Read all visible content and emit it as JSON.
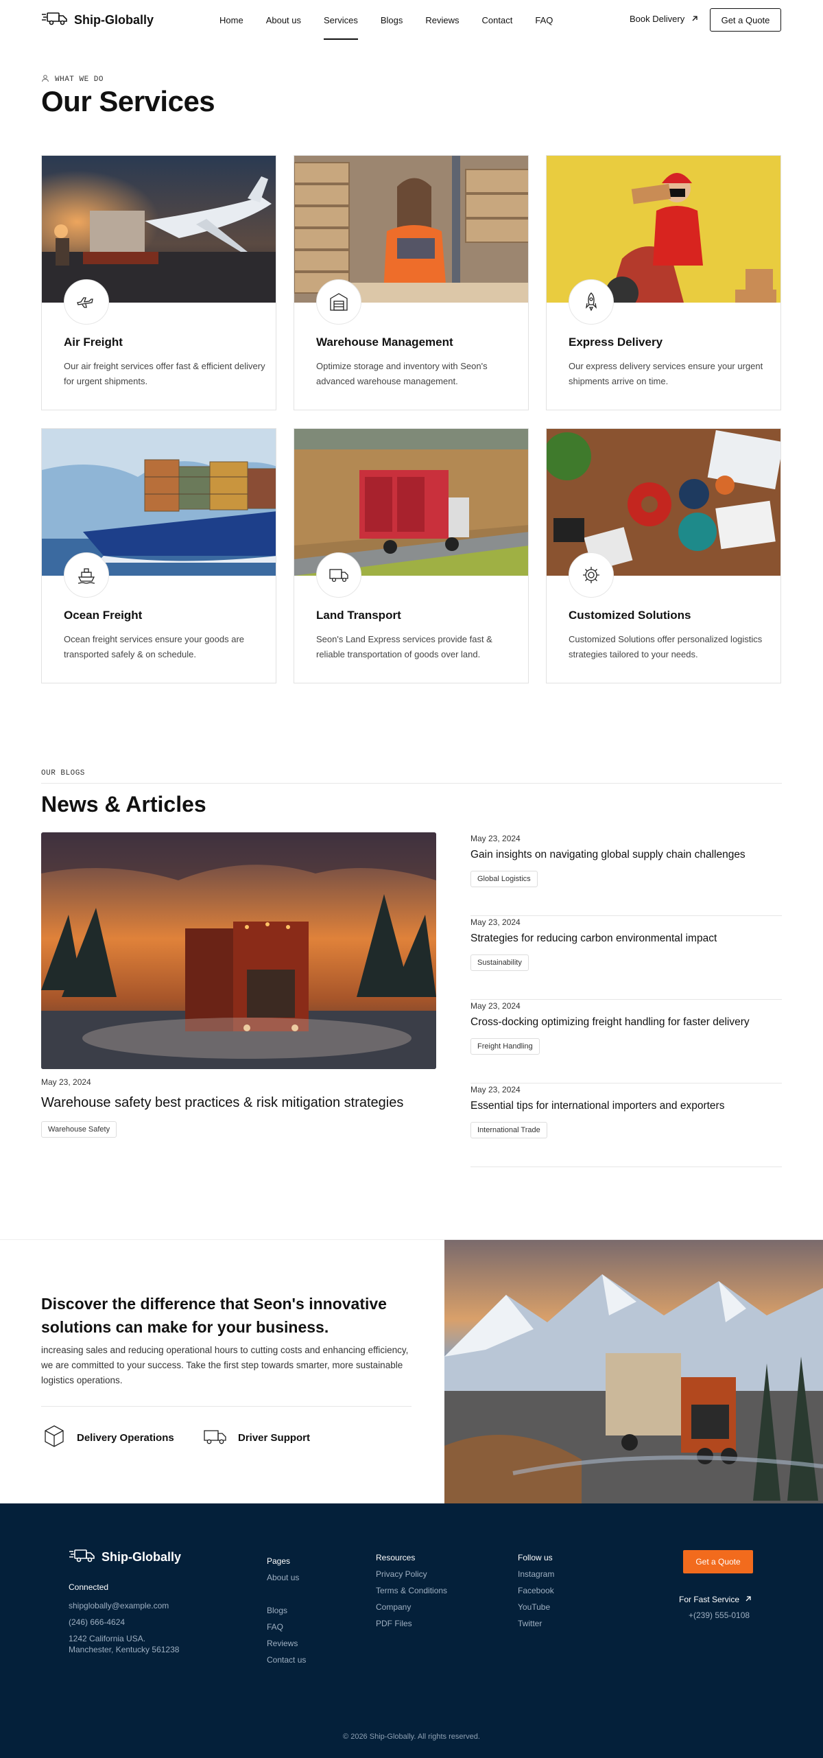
{
  "brand": "Ship-Globally",
  "nav": {
    "items": [
      "Home",
      "About us",
      "Services",
      "Blogs",
      "Reviews",
      "Contact",
      "FAQ"
    ],
    "active_index": 2,
    "book_delivery": "Book Delivery",
    "get_quote": "Get a Quote"
  },
  "services": {
    "eyebrow": "WHAT WE DO",
    "title": "Our Services",
    "items": [
      {
        "title": "Air Freight",
        "desc": "Our air freight services offer fast & efficient delivery for urgent shipments.",
        "icon": "airplane-icon"
      },
      {
        "title": "Warehouse Management",
        "desc": "Optimize storage and inventory with Seon's advanced warehouse management.",
        "icon": "warehouse-icon"
      },
      {
        "title": "Express Delivery",
        "desc": "Our express delivery services ensure your urgent shipments arrive on time.",
        "icon": "rocket-icon"
      },
      {
        "title": "Ocean Freight",
        "desc": "Ocean freight services ensure your goods are transported safely & on schedule.",
        "icon": "ship-icon"
      },
      {
        "title": "Land Transport",
        "desc": "Seon's Land Express services provide fast & reliable transportation of goods over land.",
        "icon": "truck-icon"
      },
      {
        "title": "Customized Solutions",
        "desc": "Customized Solutions offer personalized logistics strategies tailored to your needs.",
        "icon": "gear-icon"
      }
    ]
  },
  "blogs": {
    "eyebrow": "OUR BLOGS",
    "title": "News & Articles",
    "featured": {
      "date": "May 23, 2024",
      "title": "Warehouse safety best practices & risk mitigation strategies",
      "tag": "Warehouse Safety"
    },
    "posts": [
      {
        "date": "May 23, 2024",
        "title": "Gain insights on navigating global supply chain challenges",
        "tag": "Global Logistics"
      },
      {
        "date": "May 23, 2024",
        "title": "Strategies for reducing carbon environmental impact",
        "tag": "Sustainability"
      },
      {
        "date": "May 23, 2024",
        "title": "Cross-docking optimizing freight handling for faster delivery",
        "tag": "Freight Handling"
      },
      {
        "date": "May 23, 2024",
        "title": "Essential tips for international importers and exporters",
        "tag": "International Trade"
      }
    ]
  },
  "cta": {
    "heading": "Discover the difference that Seon's innovative solutions can make for your business.",
    "text": "increasing sales and reducing operational hours to cutting costs and enhancing efficiency, we are committed to your success. Take the first step towards smarter, more sustainable logistics operations.",
    "features": [
      "Delivery Operations",
      "Driver Support"
    ]
  },
  "footer": {
    "connected": "Connected",
    "email": "shipglobally@example.com",
    "phone": "(246) 666-4624",
    "address1": "1242 California USA.",
    "address2": "Manchester, Kentucky 561238",
    "pages_title": "Pages",
    "pages": [
      "About us",
      "",
      "Blogs",
      "FAQ",
      "Reviews",
      "Contact us"
    ],
    "resources_title": "Resources",
    "resources": [
      "Privacy Policy",
      "Terms & Conditions",
      "Company",
      "PDF Files"
    ],
    "follow_title": "Follow us",
    "follow": [
      "Instagram",
      "Facebook",
      "YouTube",
      "Twitter"
    ],
    "quote": "Get a Quote",
    "fast_service": "For Fast Service",
    "fast_phone": "+(239) 555-0108",
    "copyright": "© 2026 Ship-Globally. All rights reserved."
  },
  "colors": {
    "accent": "#f26b1d",
    "footer_bg": "#04203a"
  }
}
